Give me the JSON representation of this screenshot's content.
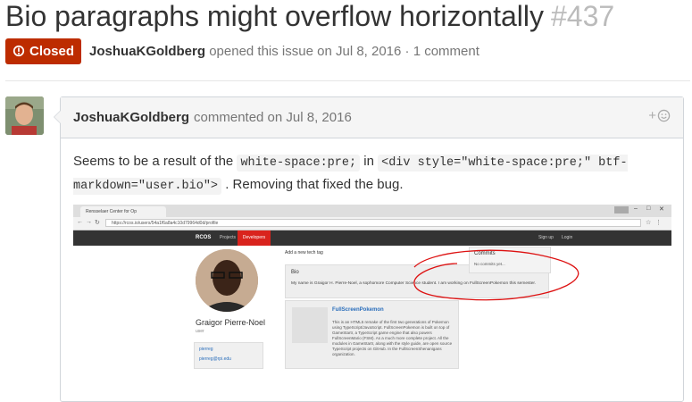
{
  "issue": {
    "title": "Bio paragraphs might overflow horizontally",
    "number": "#437",
    "state_label": "Closed",
    "author": "JoshuaKGoldberg",
    "meta_suffix": "opened this issue on Jul 8, 2016 · 1 comment",
    "state_color": "#bd2c00"
  },
  "comment": {
    "author": "JoshuaKGoldberg",
    "meta": "commented on Jul 8, 2016",
    "reaction_icon": "smiley-plus-icon",
    "body": {
      "text1": "Seems to be a result of the",
      "code1": "white-space:pre;",
      "text2": "in",
      "code2": "<div style=\"white-space:pre;\" btf-markdown=\"user.bio\">",
      "text3": ". Removing that fixed the bug."
    }
  },
  "screenshot": {
    "tab_title": "Rensselaer Center for Op",
    "url": "https://rcos.io/users/54a1f6a8a4c10d79964d0d/profile",
    "nav": {
      "brand": "RCOS",
      "projects": "Projects",
      "developers": "Developers",
      "signup": "Sign up",
      "login": "Login"
    },
    "profile": {
      "name": "Graigor Pierre-Noel",
      "role": "user",
      "link1": "pierreg",
      "link2": "pierreg@rpi.edu"
    },
    "add_tag": "Add a new tech tag",
    "bio": {
      "title": "Bio",
      "text": "My name is Graigor H. Pierre-Noel, a sophomore Computer Science student. I am working on FullScreenPokemon this semester."
    },
    "project": {
      "title": "FullScreenPokemon",
      "desc": "This is an HTML5 remake of the first two generations of Pokemon using TypeScript/JavaScript. FullScreenPokemon is built on top of GameStartr, a TypeScript game engine that also powers FullScreenMario (FSM). As a much more complete project. All the modules in GameStartr, along with the style guide, are open source TypeScript projects on GitHub. In the FullScreenShenanigans organization."
    },
    "commits": {
      "title": "Commits",
      "text": "No commits yet..."
    }
  }
}
